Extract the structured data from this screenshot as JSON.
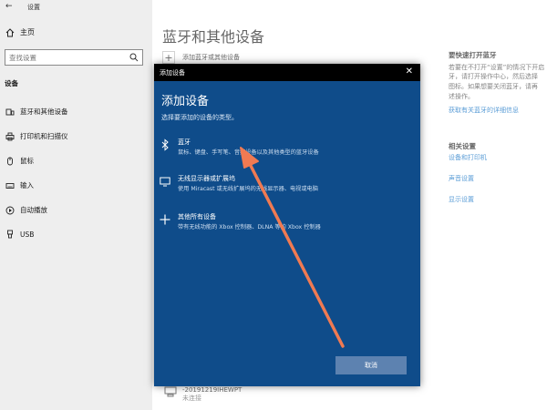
{
  "window": {
    "title": "设置",
    "back_glyph": "←"
  },
  "sidebar": {
    "home_label": "主页",
    "search": {
      "placeholder": "查找设置"
    },
    "section": "设备",
    "items": [
      {
        "label": "蓝牙和其他设备",
        "icon": "bluetooth-devices-icon"
      },
      {
        "label": "打印机和扫描仪",
        "icon": "printer-icon"
      },
      {
        "label": "鼠标",
        "icon": "mouse-icon"
      },
      {
        "label": "输入",
        "icon": "keyboard-icon"
      },
      {
        "label": "自动播放",
        "icon": "autoplay-icon"
      },
      {
        "label": "USB",
        "icon": "usb-icon"
      }
    ]
  },
  "main": {
    "title": "蓝牙和其他设备",
    "add_device_label": "添加蓝牙或其他设备",
    "device": {
      "name": "-20191219IHEWPT",
      "status": "未连接"
    }
  },
  "right_panel": {
    "quick_heading": "要快速打开蓝牙",
    "quick_lines": [
      "若要在不打开“设置”的情况下开启",
      "牙，请打开操作中心，然后选择",
      "图标。如果想要关闭蓝牙，请再",
      "述操作。"
    ],
    "bluetooth_more_link": "获取有关蓝牙的详细信息",
    "related_heading": "相关设置",
    "related_links": [
      "设备和打印机",
      "声音设置",
      "显示设置"
    ]
  },
  "dialog": {
    "window_title": "添加设备",
    "heading": "添加设备",
    "subtitle": "选择要添加的设备的类型。",
    "options": [
      {
        "title": "蓝牙",
        "desc": "鼠标、键盘、手写笔、音频设备以及其他类型的蓝牙设备",
        "icon": "bluetooth-icon"
      },
      {
        "title": "无线显示器或扩展坞",
        "desc": "使用 Miracast 或无线扩展坞的无线显示器、电视或电脑",
        "icon": "monitor-icon"
      },
      {
        "title": "其他所有设备",
        "desc": "带有无线功能的 Xbox 控制器、DLNA 等的 Xbox 控制器",
        "icon": "plus-icon"
      }
    ],
    "cancel_label": "取消"
  },
  "colors": {
    "dialog_bg": "#0f4c8a",
    "accent": "#0067c0",
    "arrow": "#f07a52"
  }
}
